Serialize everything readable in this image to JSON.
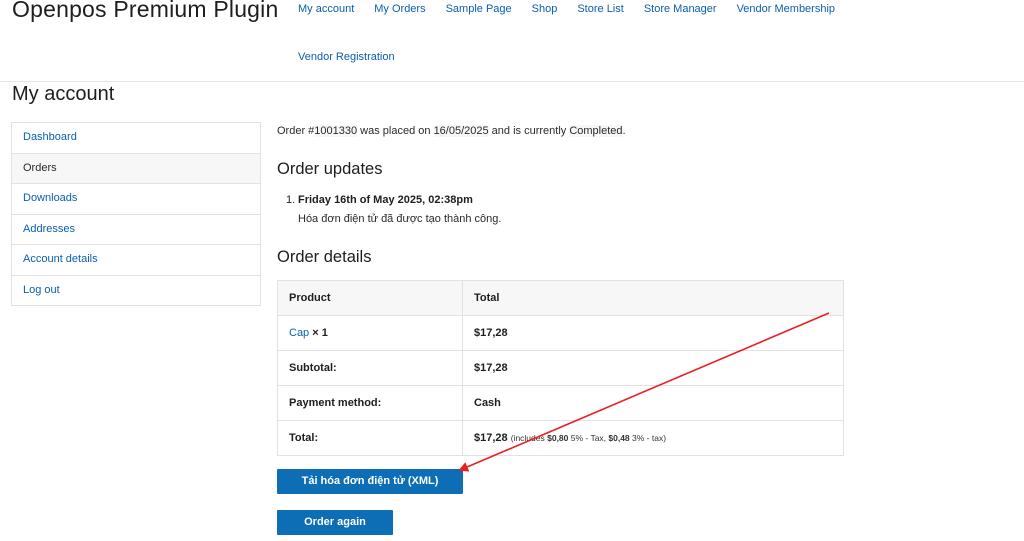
{
  "site": {
    "title": "Openpos Premium Plugin"
  },
  "nav": {
    "items": [
      {
        "label": "My account"
      },
      {
        "label": "My Orders"
      },
      {
        "label": "Sample Page"
      },
      {
        "label": "Shop"
      },
      {
        "label": "Store List"
      },
      {
        "label": "Store Manager"
      },
      {
        "label": "Vendor Membership"
      }
    ],
    "second_row": "Vendor Registration"
  },
  "page": {
    "title": "My account"
  },
  "account_nav": {
    "items": [
      {
        "label": "Dashboard"
      },
      {
        "label": "Orders"
      },
      {
        "label": "Downloads"
      },
      {
        "label": "Addresses"
      },
      {
        "label": "Account details"
      },
      {
        "label": "Log out"
      }
    ],
    "active": "Orders"
  },
  "order": {
    "intro_prefix": "Order #",
    "number": "1001330",
    "intro_mid": " was placed on ",
    "date": "16/05/2025",
    "intro_mid2": " and is currently ",
    "status": "Completed",
    "intro_end": "."
  },
  "updates": {
    "heading": "Order updates",
    "items": [
      {
        "index": "1.",
        "date": "Friday 16th of May 2025, 02:38pm",
        "text": "Hóa đơn điện tử đã được tạo thành công."
      }
    ]
  },
  "details": {
    "heading": "Order details",
    "columns": [
      "Product",
      "Total"
    ],
    "product": {
      "name": "Cap",
      "qty": " × 1",
      "total": "$17,28"
    },
    "rows": [
      {
        "label": "Subtotal:",
        "value": "$17,28"
      },
      {
        "label": "Payment method:",
        "value": "Cash"
      }
    ],
    "total": {
      "label": "Total:",
      "value": "$17,28",
      "includes_prefix": "(includes ",
      "tax1_amount": "$0,80",
      "tax1_label": " 5% - Tax, ",
      "tax2_amount": "$0,48",
      "tax2_label": " 3% - tax)"
    }
  },
  "buttons": {
    "download_xml": "Tải hóa đơn điện tử (XML)",
    "order_again": "Order again"
  },
  "colors": {
    "link": "#0a5fae",
    "button": "#0d6db5",
    "annotation_arrow": "#e8201f"
  }
}
